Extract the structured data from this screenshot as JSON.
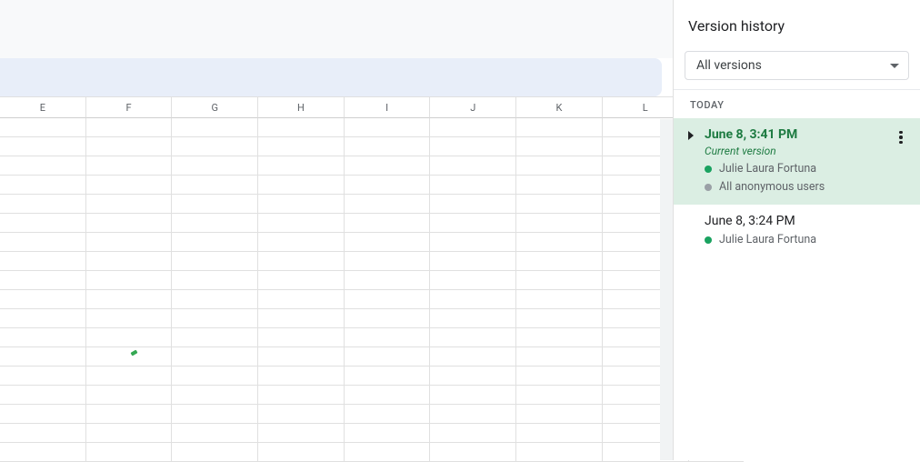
{
  "panel": {
    "title": "Version history",
    "filter": {
      "selected": "All versions"
    },
    "group_label": "TODAY",
    "versions": [
      {
        "timestamp": "June 8, 3:41 PM",
        "current_label": "Current version",
        "selected": true,
        "editors": [
          {
            "name": "Julie Laura Fortuna",
            "color": "#1aa260"
          },
          {
            "name": "All anonymous users",
            "color": "#9aa0a6"
          }
        ]
      },
      {
        "timestamp": "June 8, 3:24 PM",
        "selected": false,
        "editors": [
          {
            "name": "Julie Laura Fortuna",
            "color": "#1aa260"
          }
        ]
      }
    ]
  },
  "sheet": {
    "columns": [
      "E",
      "F",
      "G",
      "H",
      "I",
      "J",
      "K",
      "L"
    ],
    "visible_rows": 18
  }
}
